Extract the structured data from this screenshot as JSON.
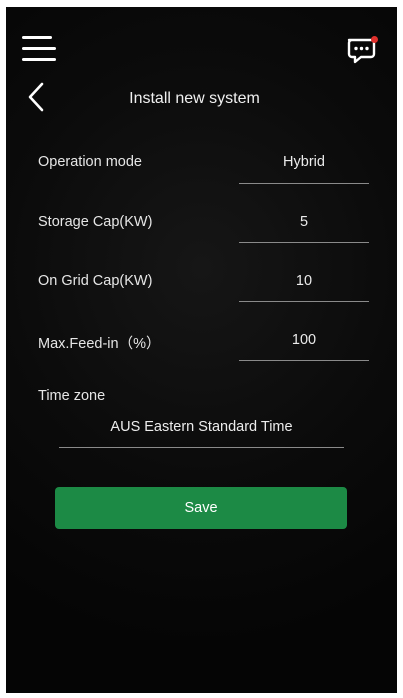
{
  "header": {
    "title": "Install new system",
    "icons": {
      "menu": "hamburger-menu-icon",
      "messages": "chat-bubble-icon",
      "back": "chevron-left-icon"
    },
    "notification_color": "#e0302c"
  },
  "form": {
    "fields": [
      {
        "label": "Operation mode",
        "value": "Hybrid"
      },
      {
        "label": "Storage Cap(KW)",
        "value": "5"
      },
      {
        "label": "On Grid Cap(KW)",
        "value": "10"
      },
      {
        "label": "Max.Feed-in（%）",
        "value": "100"
      }
    ],
    "time_zone": {
      "label": "Time zone",
      "value": "AUS Eastern Standard Time"
    }
  },
  "actions": {
    "save_label": "Save",
    "save_color": "#1c8a45"
  }
}
